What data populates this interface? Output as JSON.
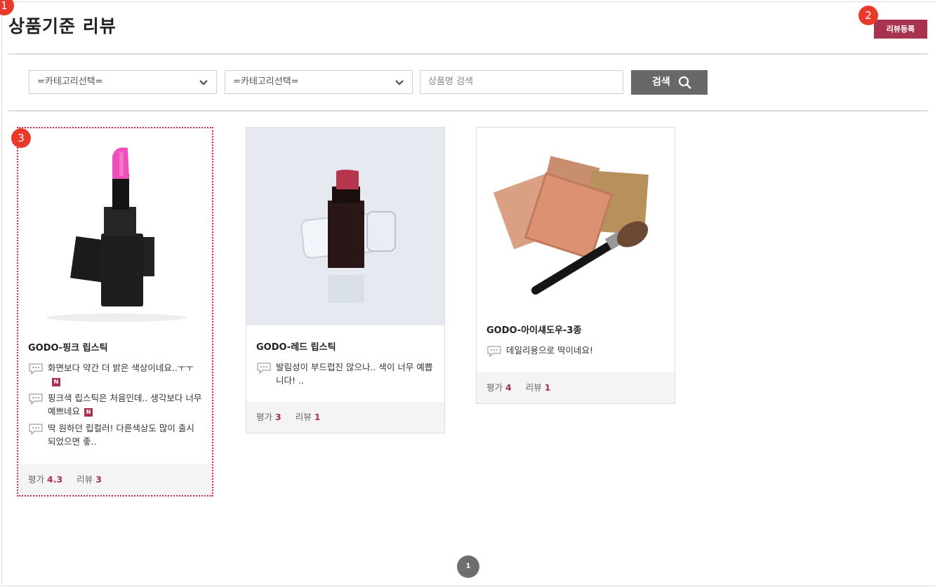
{
  "callouts": [
    "1",
    "2",
    "3"
  ],
  "header": {
    "title": "상품기준 리뷰",
    "register_label": "리뷰등록"
  },
  "filters": {
    "category1": "=카테고리선택=",
    "category2": "=카테고리선택=",
    "search_placeholder": "상품명 검색",
    "search_label": "검색"
  },
  "colors": {
    "accent": "#a83351",
    "button_gray": "#686868",
    "callout": "#e8392a"
  },
  "products": [
    {
      "name": "GODO-핑크 립스틱",
      "image": "pink-lipstick",
      "reviews": [
        {
          "text": "화면보다 약간 더 밝은 색상이네요..ㅜㅜ",
          "new": "N"
        },
        {
          "text": "핑크색 립스틱은 처음인데.. 생각보다 너무 예쁘네요",
          "new": "N"
        },
        {
          "text": "딱 원하던 립컬러! 다른색상도 많이 출시되었으면 좋..",
          "new": ""
        }
      ],
      "rating_label": "평가",
      "rating": "4.3",
      "review_label": "리뷰",
      "review_count": "3"
    },
    {
      "name": "GODO-레드 립스틱",
      "image": "red-lipstick",
      "reviews": [
        {
          "text": "발림성이 부드럽진 않으나.. 색이 너무 예쁩니다! ..",
          "new": ""
        }
      ],
      "rating_label": "평가",
      "rating": "3",
      "review_label": "리뷰",
      "review_count": "1"
    },
    {
      "name": "GODO-아이섀도우-3종",
      "image": "eyeshadow-palette",
      "reviews": [
        {
          "text": "데일리용으로 딱이네요!",
          "new": ""
        }
      ],
      "rating_label": "평가",
      "rating": "4",
      "review_label": "리뷰",
      "review_count": "1"
    }
  ],
  "pagination": {
    "current": "1"
  }
}
